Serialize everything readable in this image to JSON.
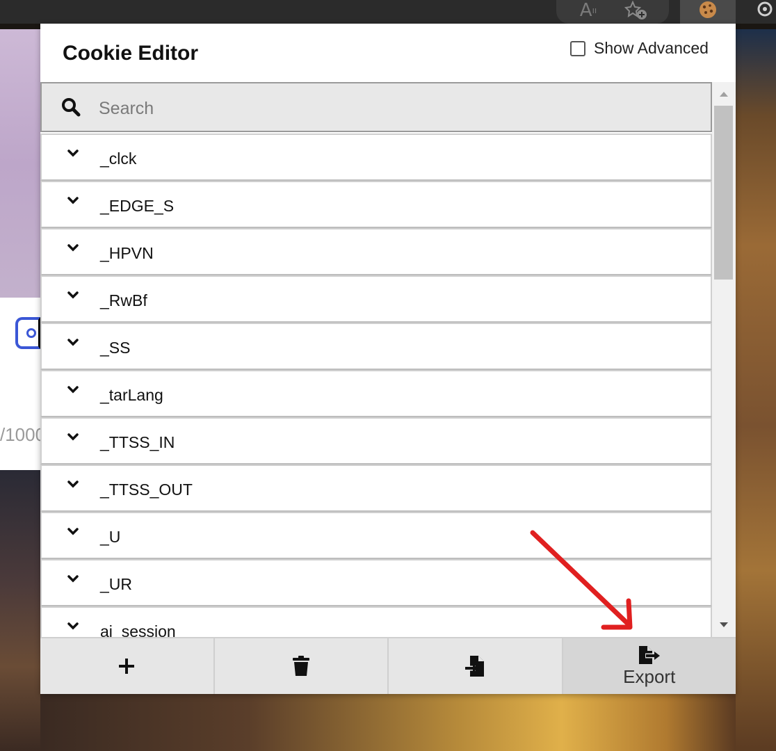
{
  "popup": {
    "title": "Cookie Editor",
    "show_advanced_label": "Show Advanced",
    "show_advanced_checked": false
  },
  "search": {
    "placeholder": "Search",
    "value": ""
  },
  "cookies": [
    {
      "name": "_clck"
    },
    {
      "name": "_EDGE_S"
    },
    {
      "name": "_HPVN"
    },
    {
      "name": "_RwBf"
    },
    {
      "name": "_SS"
    },
    {
      "name": "_tarLang"
    },
    {
      "name": "_TTSS_IN"
    },
    {
      "name": "_TTSS_OUT"
    },
    {
      "name": "_U"
    },
    {
      "name": "_UR"
    },
    {
      "name": "ai_session"
    }
  ],
  "footer": {
    "add_icon": "plus-icon",
    "delete_icon": "trash-icon",
    "import_icon": "import-icon",
    "export_icon": "export-icon",
    "export_label": "Export"
  },
  "background": {
    "partial_text": "/1000"
  },
  "annotation": {
    "arrow_color": "#e02020"
  }
}
